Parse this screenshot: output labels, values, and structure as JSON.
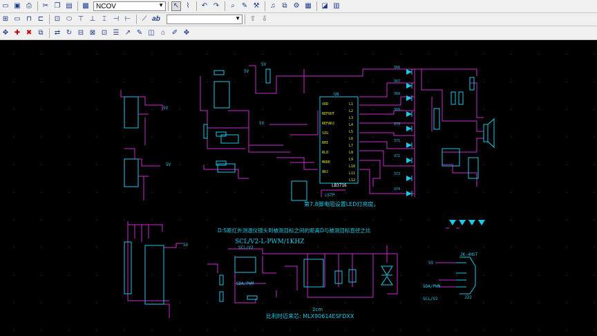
{
  "toolbar": {
    "net_selector_value": "NCOV",
    "second_selector_value": ""
  },
  "icons": {
    "row1": [
      "open-icon",
      "save-icon",
      "print-icon",
      "cut-icon",
      "copy-icon",
      "paste-icon",
      "component-icon",
      "undo-icon",
      "redo-icon",
      "search-icon",
      "edit-icon",
      "wrench-icon",
      "music-note-icon",
      "copy-component-icon",
      "component-properties-icon",
      "zoom-fit-icon",
      "board-icon"
    ],
    "row2": [
      "place-part-icon",
      "place-bus-icon",
      "place-connector-icon",
      "place-net-label-icon",
      "place-graphic-icon",
      "place-port-icon",
      "place-power-icon",
      "place-ground-icon",
      "place-no-connect-icon",
      "place-junction-icon",
      "place-pin-icon",
      "place-text-icon",
      "move-up-icon",
      "move-down-icon"
    ],
    "row3": [
      "move-icon",
      "add-icon",
      "delete-icon",
      "replace-icon",
      "flip-icon",
      "rotate-icon",
      "align-icon",
      "group-icon",
      "ungroup-icon",
      "properties-icon",
      "label-icon",
      "library-icon",
      "bom-icon",
      "netlist-icon",
      "report-icon"
    ]
  },
  "schematic": {
    "labels": {
      "v5_1": "5V",
      "v5_2": "5V",
      "v5_3": "5V",
      "v5_4": "5V",
      "v5_5": "5V",
      "v5_6": "5V",
      "v5_7": "5V",
      "u8": "U8",
      "u8_part": "LB3716",
      "lstp": "LSTP",
      "note_led": "第7,8脚电阻设置LED灯亮度。",
      "title_ir": "D:S距红外测温仪镜头到被测目标之间的距离D与被测目标直径之比",
      "title_scl": "SCL/V2-L-PWM/1KHZ",
      "sensor_line": "比利时迈来芯: MLX90614ESFDXX",
      "dist": "2cm",
      "scl_n": "SCL/V2",
      "sda_n": "SDA/PWM",
      "scl_r": "SCL/V2",
      "sda_r": "SDA/PWM",
      "j22": "J22",
      "jk": "JK-4HST",
      "pins": [
        "L1",
        "L2",
        "L3",
        "L4",
        "L5",
        "L6",
        "L7",
        "L8",
        "L9",
        "L10",
        "L11",
        "L12"
      ],
      "pins_left": [
        "VDD",
        "REFOUT",
        "REFADJ",
        "SIG",
        "RHI",
        "RLO",
        "MODE",
        "ADJ"
      ],
      "led_nums": [
        "366",
        "367",
        "368",
        "369",
        "370",
        "371",
        "372",
        "373",
        "374"
      ]
    }
  }
}
